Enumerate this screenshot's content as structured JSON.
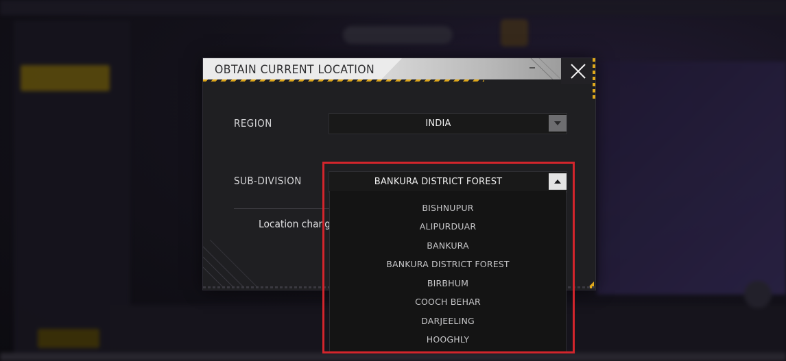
{
  "dialog": {
    "title": "OBTAIN CURRENT LOCATION",
    "region_label": "REGION",
    "region_value": "INDIA",
    "subdivision_label": "SUB-DIVISION",
    "subdivision_value": "BANKURA DISTRICT FOREST",
    "location_note": "Location chang"
  },
  "dropdown": {
    "options": [
      "BISHNUPUR",
      "ALIPURDUAR",
      "BANKURA",
      "BANKURA DISTRICT FOREST",
      "BIRBHUM",
      "COOCH BEHAR",
      "DARJEELING",
      "HOOGHLY"
    ]
  },
  "icons": {
    "close": "close-icon",
    "region_arrow": "chevron-down-icon",
    "subdivision_arrow": "chevron-up-icon"
  },
  "colors": {
    "accent_yellow": "#e0a81c",
    "highlight_red": "#d3252c",
    "dialog_bg": "#1f1f22",
    "header_bg": "#ebebeb"
  }
}
